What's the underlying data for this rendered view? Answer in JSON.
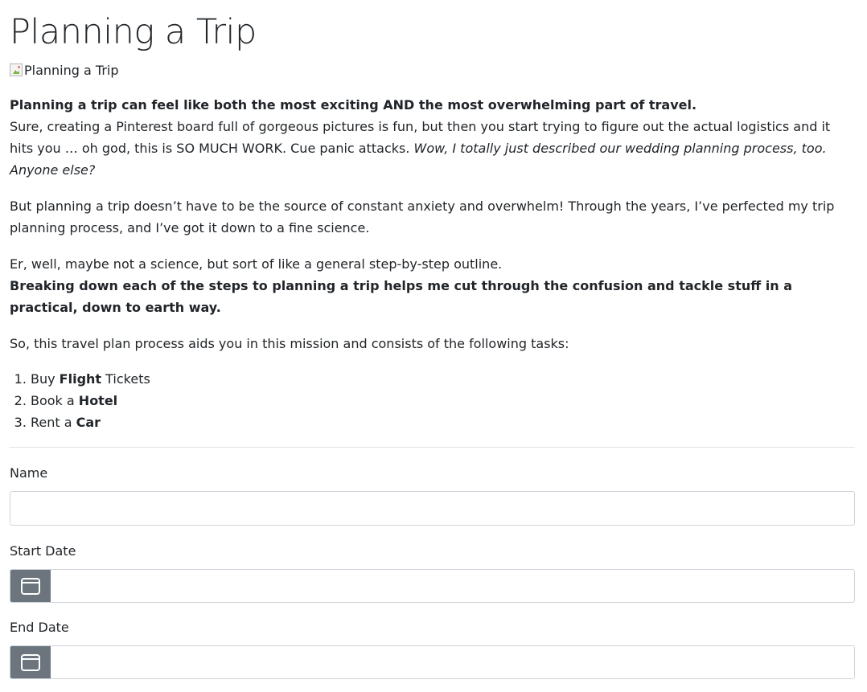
{
  "page": {
    "title": "Planning a Trip",
    "hero_image_alt": "Planning a Trip"
  },
  "intro": {
    "bold_lead": "Planning a trip can feel like both the most exciting AND the most overwhelming part of travel.",
    "text1": "Sure, creating a Pinterest board full of gorgeous pictures is fun, but then you start trying to figure out the actual logistics and it hits you … oh god, this is SO MUCH WORK. Cue panic attacks. ",
    "italic": "Wow, I totally just described our wedding planning process, too. Anyone else?"
  },
  "paragraph2": "But planning a trip doesn’t have to be the source of constant anxiety and overwhelm! Through the years, I’ve perfected my trip planning process, and I’ve got it down to a fine science.",
  "paragraph3": {
    "text": "Er, well, maybe not a science, but sort of like a general step-by-step outline.",
    "bold": "Breaking down each of the steps to planning a trip helps me cut through the confusion and tackle stuff in a practical, down to earth way."
  },
  "paragraph4": "So, this travel plan process aids you in this mission and consists of the following tasks:",
  "tasks": [
    {
      "prefix": "Buy ",
      "bold": "Flight",
      "suffix": " Tickets"
    },
    {
      "prefix": "Book a ",
      "bold": "Hotel",
      "suffix": ""
    },
    {
      "prefix": "Rent a ",
      "bold": "Car",
      "suffix": ""
    }
  ],
  "form": {
    "name_label": "Name",
    "name_value": "",
    "start_date_label": "Start Date",
    "start_date_value": "",
    "end_date_label": "End Date",
    "end_date_value": ""
  },
  "icons": {
    "calendar": "calendar-icon",
    "addon_color": "#6c757d"
  }
}
